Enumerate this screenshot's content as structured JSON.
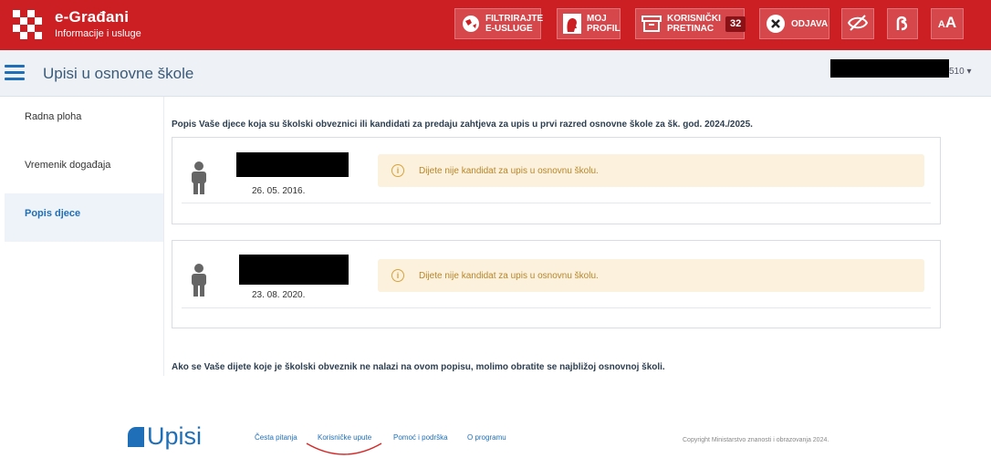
{
  "header": {
    "brand_title": "e-Građani",
    "brand_subtitle": "Informacije i usluge",
    "buttons": {
      "filter": "FILTRIRAJTE E-USLUGE",
      "profile": "MOJ PROFIL",
      "inbox": "KORISNIČKI PRETINAC",
      "inbox_count": "32",
      "logout": "ODJAVA",
      "font_size": "AA"
    }
  },
  "subheader": {
    "title": "Upisi u osnovne škole",
    "user_suffix": "510 ▾"
  },
  "sidebar": {
    "items": [
      {
        "label": "Radna ploha"
      },
      {
        "label": "Vremenik događaja"
      },
      {
        "label": "Popis djece"
      }
    ]
  },
  "main": {
    "intro": "Popis Vaše djece koja su školski obveznici ili kandidati za predaju zahtjeva za upis u prvi razred osnovne škole za šk. god. 2024./2025.",
    "children": [
      {
        "dob": "26. 05. 2016.",
        "status": "Dijete nije kandidat za upis u osnovnu školu."
      },
      {
        "dob": "23. 08. 2020.",
        "status": "Dijete nije kandidat za upis u osnovnu školu."
      }
    ],
    "note": "Ako se Vaše dijete koje je školski obveznik ne nalazi na ovom popisu, molimo obratite se najbližoj osnovnoj školi."
  },
  "footer": {
    "logo_text": "Upisi",
    "links": [
      "Česta pitanja",
      "Korisničke upute",
      "Pomoć i podrška",
      "O programu"
    ],
    "copyright": "Copyright Ministarstvo znanosti i obrazovanja 2024."
  }
}
